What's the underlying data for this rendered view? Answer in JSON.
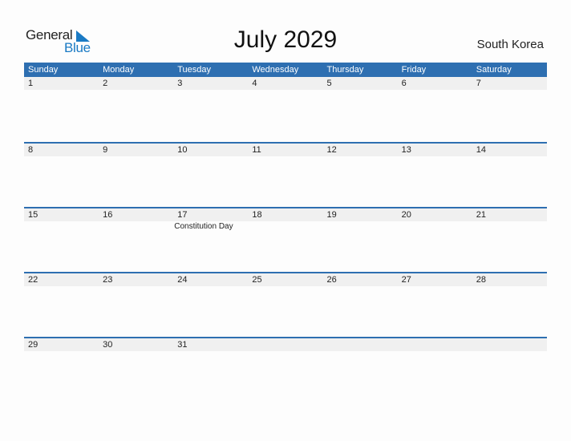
{
  "logo": {
    "general": "General",
    "blue": "Blue"
  },
  "title": "July 2029",
  "country": "South Korea",
  "weekdays": [
    "Sunday",
    "Monday",
    "Tuesday",
    "Wednesday",
    "Thursday",
    "Friday",
    "Saturday"
  ],
  "weeks": [
    {
      "days": [
        "1",
        "2",
        "3",
        "4",
        "5",
        "6",
        "7"
      ],
      "events": [
        "",
        "",
        "",
        "",
        "",
        "",
        ""
      ]
    },
    {
      "days": [
        "8",
        "9",
        "10",
        "11",
        "12",
        "13",
        "14"
      ],
      "events": [
        "",
        "",
        "",
        "",
        "",
        "",
        ""
      ]
    },
    {
      "days": [
        "15",
        "16",
        "17",
        "18",
        "19",
        "20",
        "21"
      ],
      "events": [
        "",
        "",
        "Constitution Day",
        "",
        "",
        "",
        ""
      ]
    },
    {
      "days": [
        "22",
        "23",
        "24",
        "25",
        "26",
        "27",
        "28"
      ],
      "events": [
        "",
        "",
        "",
        "",
        "",
        "",
        ""
      ]
    },
    {
      "days": [
        "29",
        "30",
        "31",
        "",
        "",
        "",
        ""
      ],
      "events": [
        "",
        "",
        "",
        "",
        "",
        "",
        ""
      ]
    }
  ],
  "colors": {
    "header_bg": "#2e6fb1",
    "brand_blue": "#1a7ac4",
    "date_strip": "#f0f0f0"
  }
}
